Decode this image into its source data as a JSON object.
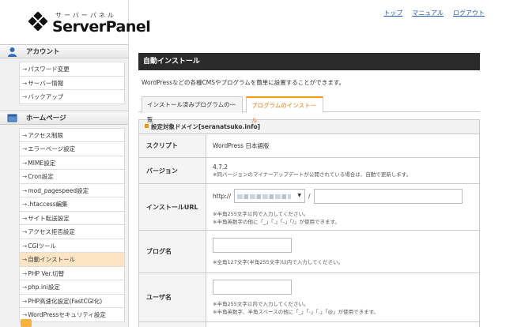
{
  "header": {
    "logo_kana": "サーバーパネル",
    "logo_name": "ServerPanel",
    "nav": [
      "トップ",
      "マニュアル",
      "ログアウト"
    ]
  },
  "sidebar": {
    "sections": [
      {
        "title": "アカウント",
        "icon": "person-icon",
        "items": [
          "パスワード変更",
          "サーバー情報",
          "バックアップ"
        ]
      },
      {
        "title": "ホームページ",
        "icon": "homepage-icon",
        "items": [
          "アクセス制限",
          "エラーページ設定",
          "MIME設定",
          "Cron設定",
          "mod_pagespeed設定",
          ".htaccess編集",
          "サイト転送設定",
          "アクセス拒否設定",
          "CGIツール",
          "自動インストール",
          "PHP Ver.切替",
          "php.ini設定",
          "PHP高速化設定(FastCGI化)",
          "WordPressセキュリティ設定"
        ]
      }
    ],
    "active_item": "自動インストール"
  },
  "main": {
    "title": "自動インストール",
    "description": "WordPressなどの各種CMSやプログラムを簡単に設置することができます。",
    "tabs": [
      "インストール済みプログラムの一覧",
      "プログラムのインストール"
    ],
    "active_tab": "プログラムのインストール",
    "panel_title": "設定対象ドメイン[seranatsuko.info]",
    "rows": {
      "script": {
        "label": "スクリプト",
        "value": "WordPress 日本語版"
      },
      "version": {
        "label": "バージョン",
        "value": "4.7.2",
        "note": "※同バージョンのマイナーアップデートが公開されている場合は、自動で更新します。"
      },
      "install_url": {
        "label": "インストールURL",
        "prefix": "http://",
        "slash": "/",
        "note1": "※半角255文字以内で入力してください。",
        "note2": "※半角英数字の他に「_」「.」「-」「/」が使用できます。"
      },
      "blog_name": {
        "label": "ブログ名",
        "note": "※全角127文字(半角255文字)以内で入力してください。"
      },
      "user_name": {
        "label": "ユーザ名",
        "note1": "※半角255文字以内で入力してください。",
        "note2": "※半角英数字、半角スペースの他に「_」「-」「.」「@」が使用できます。"
      }
    }
  },
  "colors": {
    "accent": "#f39800",
    "title_bar": "#2b2b2b",
    "link": "#2a5db0",
    "active_bg": "#fde5c3"
  }
}
